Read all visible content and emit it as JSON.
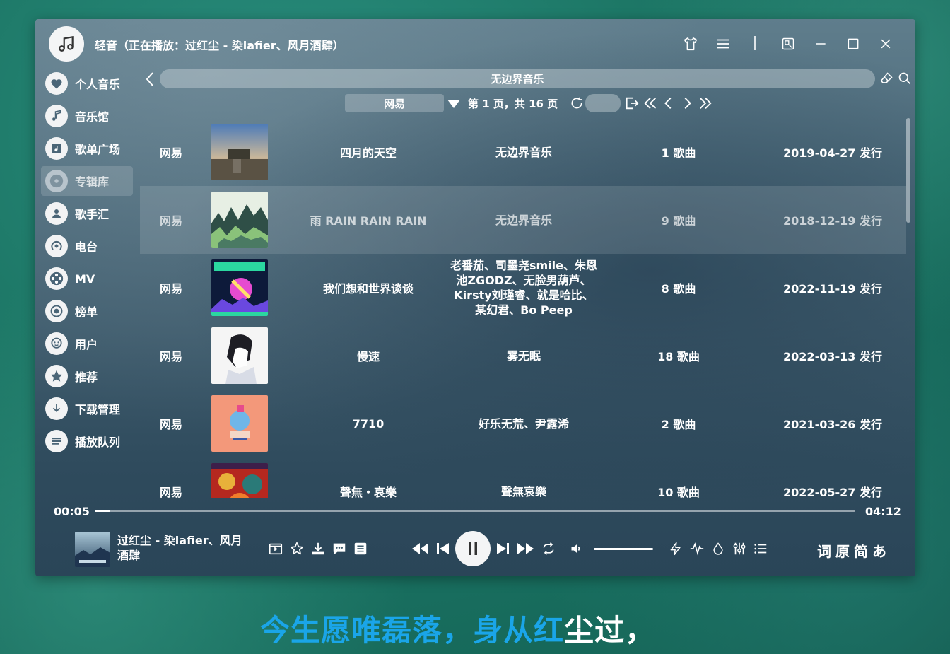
{
  "window": {
    "title": "轻音（正在播放：过红尘 - 染lafier、风月酒肆）"
  },
  "sidebar": {
    "items": [
      {
        "label": "个人音乐",
        "icon": "heart-icon"
      },
      {
        "label": "音乐馆",
        "icon": "music-note-icon"
      },
      {
        "label": "歌单广场",
        "icon": "playlist-icon"
      },
      {
        "label": "专辑库",
        "icon": "disc-icon",
        "active": true
      },
      {
        "label": "歌手汇",
        "icon": "person-icon"
      },
      {
        "label": "电台",
        "icon": "radio-icon"
      },
      {
        "label": "MV",
        "icon": "film-reel-icon"
      },
      {
        "label": "榜单",
        "icon": "chart-icon"
      },
      {
        "label": "用户",
        "icon": "user-face-icon"
      },
      {
        "label": "推荐",
        "icon": "star-icon"
      },
      {
        "label": "下载管理",
        "icon": "download-icon"
      },
      {
        "label": "播放队列",
        "icon": "queue-icon"
      }
    ]
  },
  "search": {
    "value": "无边界音乐"
  },
  "pager": {
    "source": "网易",
    "page_text": "第 1 页，共 16 页"
  },
  "albums": [
    {
      "source": "网易",
      "name": "四月的天空",
      "artist": "无边界音乐",
      "count": "1 歌曲",
      "date": "2019-04-27 发行"
    },
    {
      "source": "网易",
      "name": "雨 RAIN RAIN RAIN",
      "artist": "无边界音乐",
      "count": "9 歌曲",
      "date": "2018-12-19 发行"
    },
    {
      "source": "网易",
      "name": "我们想和世界谈谈",
      "artist": "老番茄、司墨尧smile、朱恩池ZGODZ、无脸男葫芦、Kirsty刘瑾睿、就是哈比、某幻君、Bo Peep",
      "count": "8 歌曲",
      "date": "2022-11-19 发行"
    },
    {
      "source": "网易",
      "name": "慢速",
      "artist": "雾无眠",
      "count": "18 歌曲",
      "date": "2022-03-13 发行"
    },
    {
      "source": "网易",
      "name": "7710",
      "artist": "好乐无荒、尹露浠",
      "count": "2 歌曲",
      "date": "2021-03-26 发行"
    },
    {
      "source": "网易",
      "name": "聲無・哀樂",
      "artist": "聲無哀樂",
      "count": "10 歌曲",
      "date": "2022-05-27 发行"
    }
  ],
  "player": {
    "current_time": "00:05",
    "total_time": "04:12",
    "progress": 0.02,
    "volume": 1.0,
    "now_playing": "过红尘 - 染lafier、风月酒肆",
    "lyric_buttons": [
      "词",
      "原",
      "简",
      "あ"
    ]
  },
  "desktop_lyric": {
    "sung": "今生愿唯磊落，身从红",
    "unsung": "尘过，"
  }
}
